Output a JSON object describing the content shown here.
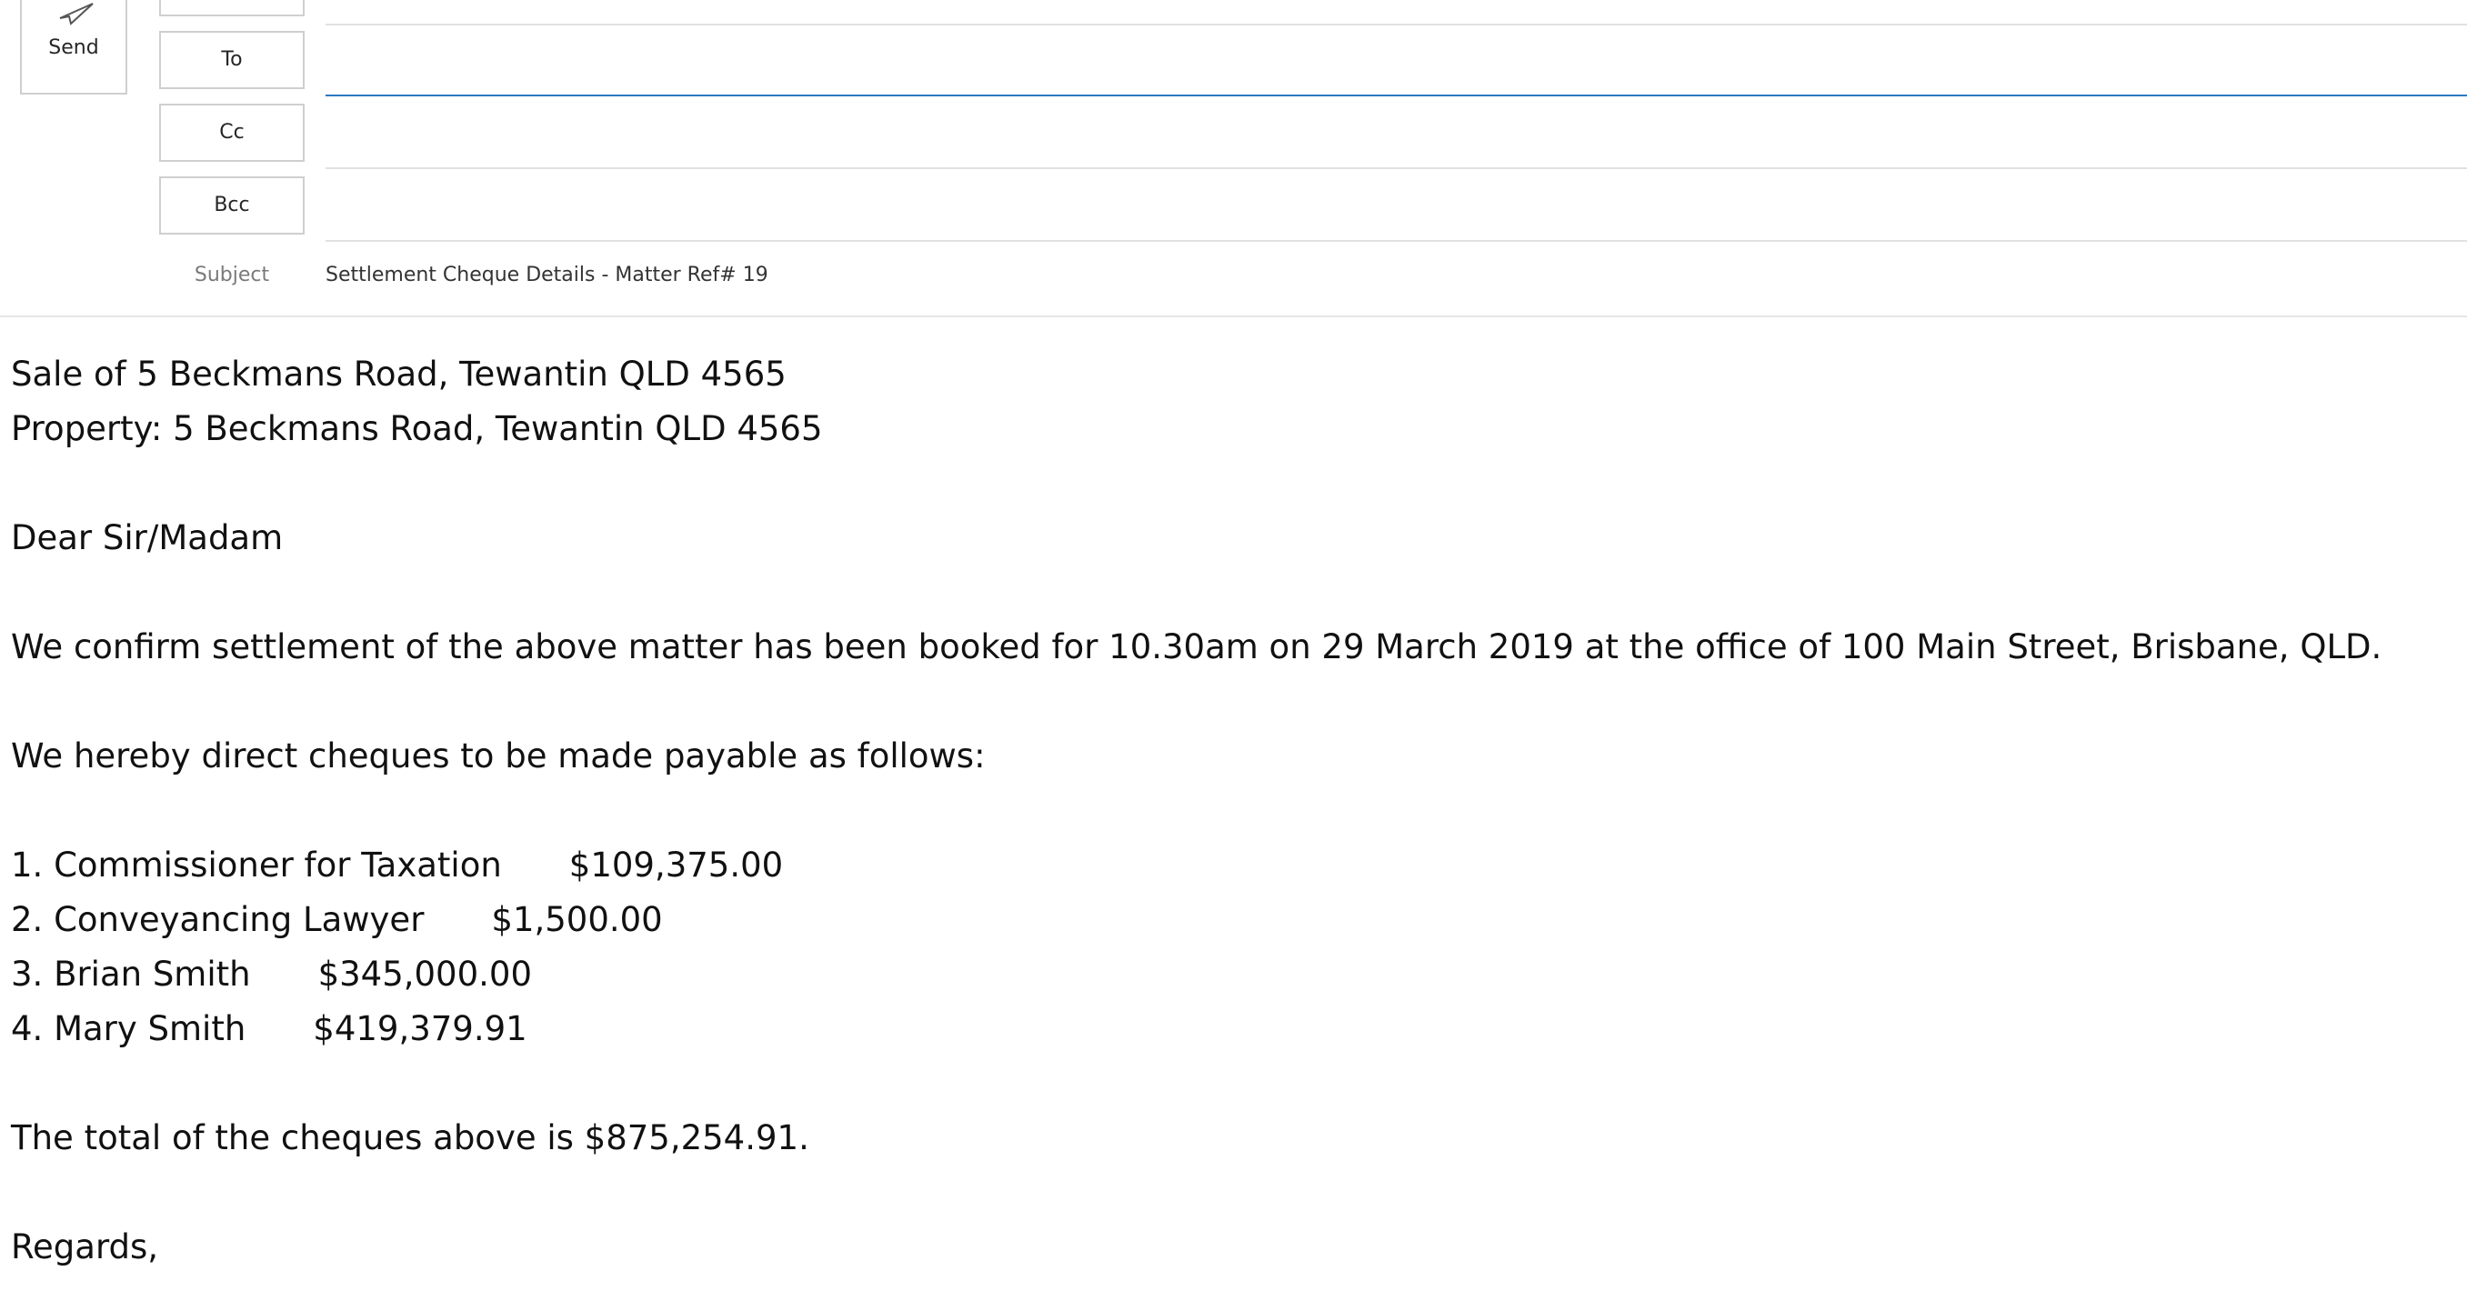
{
  "toolbar": {
    "send_label": "Send"
  },
  "header": {
    "to_label": "To",
    "cc_label": "Cc",
    "bcc_label": "Bcc",
    "subject_label": "Subject",
    "subject_value": "Settlement Cheque Details - Matter Ref# 19",
    "to_value": "",
    "cc_value": "",
    "bcc_value": ""
  },
  "body": {
    "heading_line1": "Sale of 5 Beckmans Road, Tewantin QLD 4565",
    "heading_line2": "Property: 5 Beckmans Road, Tewantin QLD 4565",
    "salutation": "Dear Sir/Madam",
    "confirm": "We confirm settlement of the above matter has been booked for 10.30am on 29 March 2019 at the office of 100 Main Street, Brisbane, QLD.",
    "direct": "We hereby direct cheques to be made payable as follows:",
    "payees": [
      {
        "label": "1. Commissioner for Taxation",
        "amount": "$109,375.00"
      },
      {
        "label": "2. Conveyancing Lawyer",
        "amount": "$1,500.00"
      },
      {
        "label": "3. Brian Smith",
        "amount": "$345,000.00"
      },
      {
        "label": "4. Mary Smith",
        "amount": "$419,379.91"
      }
    ],
    "total": "The total of the cheques above is $875,254.91.",
    "closing": "Regards,"
  },
  "colors": {
    "active_field_underline": "#2b79c2",
    "border": "#cfcfcf"
  },
  "icons": {
    "send": "send-paper-plane-icon"
  }
}
